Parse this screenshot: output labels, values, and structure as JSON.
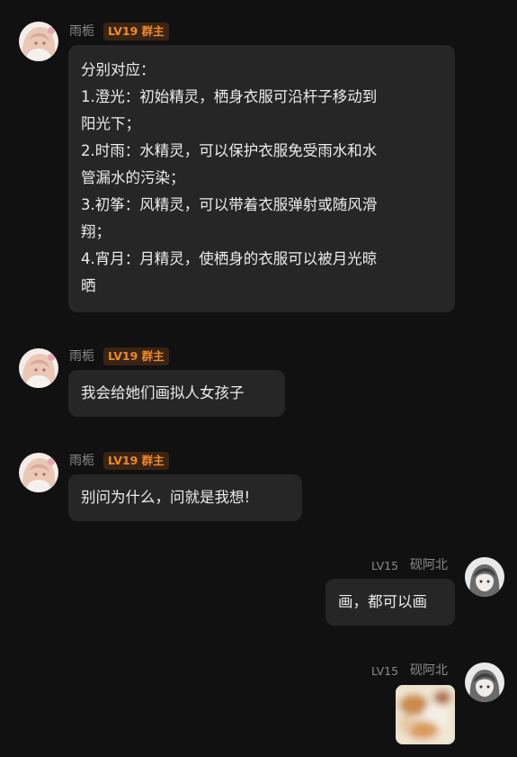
{
  "messages": [
    {
      "sender": "雨栀",
      "badge": "LV19 群主",
      "lines": [
        "分别对应：",
        "1.澄光：初始精灵，栖身衣服可沿杆子移动到",
        "阳光下；",
        "2.时雨：水精灵，可以保护衣服免受雨水和水",
        "管漏水的污染；",
        "3.初筝：风精灵，可以带着衣服弹射或随风滑",
        "翔；",
        "4.宵月：月精灵，使栖身的衣服可以被月光晾",
        "晒"
      ]
    },
    {
      "sender": "雨栀",
      "badge": "LV19 群主",
      "text": "我会给她们画拟人女孩子"
    },
    {
      "sender": "雨栀",
      "badge": "LV19 群主",
      "text": "别问为什么，问就是我想!"
    },
    {
      "sender": "砚阿北",
      "level": "LV15",
      "text": "画，都可以画"
    },
    {
      "sender": "砚阿北",
      "level": "LV15",
      "image": "blurred-photo"
    }
  ],
  "colors": {
    "background": "#111111",
    "bubble": "#262626",
    "badge_text": "#f08a2c",
    "badge_bg": "#3a2414",
    "name_text": "#8a8a8a"
  }
}
